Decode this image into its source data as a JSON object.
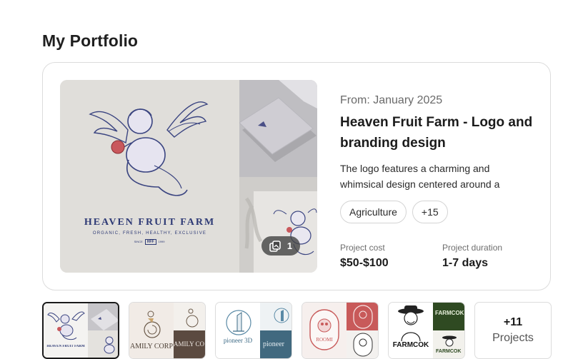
{
  "page": {
    "title": "My Portfolio"
  },
  "project": {
    "from": "From: January 2025",
    "title": "Heaven Fruit Farm - Logo and branding design",
    "description": "The logo features a charming and whimsical design centered around a",
    "tags": [
      "Agriculture",
      "+15"
    ],
    "image_count": "1",
    "cost_label": "Project cost",
    "cost_value": "$50-$100",
    "duration_label": "Project duration",
    "duration_value": "1-7 days",
    "image": {
      "brand": "HEAVEN FRUIT FARM",
      "tagline": "ORGANIC, FRESH, HEALTHY, EXCLUSIVE",
      "mark_left": "SINCE",
      "mark_center": "HFF",
      "mark_right": "1999"
    }
  },
  "thumbnails": [
    {
      "caption": "HEAVEN FRUIT FARM",
      "selected": true
    },
    {
      "caption": "AMILY CORP",
      "right_caption": "AMILY CO"
    },
    {
      "caption": "pioneer 3D",
      "right_caption": "pioneer"
    },
    {
      "caption": "ROOMI"
    },
    {
      "caption": "FARMCOK",
      "right_top_caption": "FARMCOK",
      "right_bottom_caption": "FARMCOK"
    }
  ],
  "more": {
    "count": "+11",
    "label": "Projects"
  },
  "colors": {
    "brand_navy": "#2e3a75",
    "border": "#dcdcdc",
    "badge_bg": "#464646"
  }
}
